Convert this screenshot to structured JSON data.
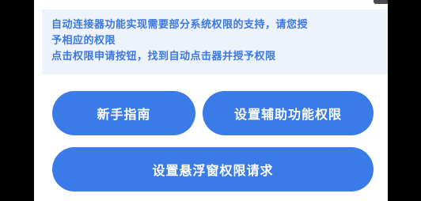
{
  "notice": {
    "line1": "自动连接器功能实现需要部分系统权限的支持，请您授",
    "line2": "予相应的权限",
    "line3": "点击权限申请按钮，找到自动点击器并授予权限"
  },
  "buttons": {
    "guide_label": "新手指南",
    "accessibility_label": "设置辅助功能权限",
    "overlay_label": "设置悬浮窗权限请求"
  },
  "colors": {
    "accent": "#3a7be8",
    "notice_text": "#3a78e6",
    "notice_bg": "#eef3fb"
  }
}
